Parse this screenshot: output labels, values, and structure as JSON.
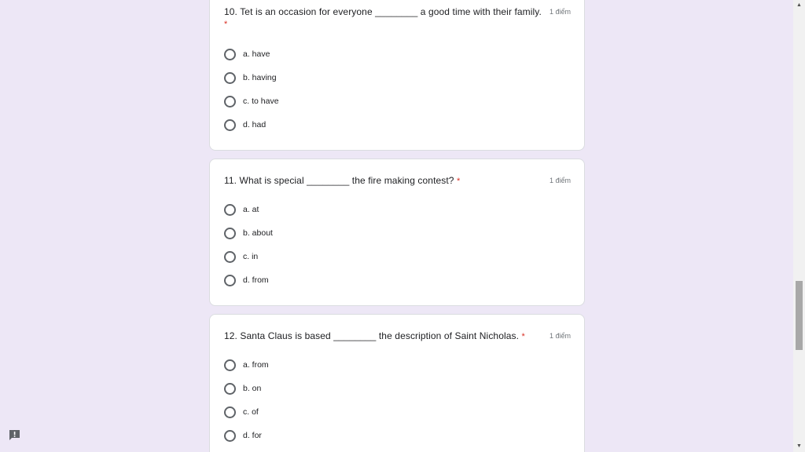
{
  "questions": [
    {
      "title": "10. Tet is an occasion for everyone ________ a good time with their family.",
      "required_mark": "*",
      "points": "1 điểm",
      "options": [
        "a. have",
        "b. having",
        "c. to have",
        "d. had"
      ]
    },
    {
      "title": "11. What is special ________ the fire making contest?",
      "required_mark": "*",
      "points": "1 điểm",
      "options": [
        "a. at",
        "b. about",
        "c. in",
        "d. from"
      ]
    },
    {
      "title": "12. Santa Claus is based ________ the description of Saint Nicholas.",
      "required_mark": "*",
      "points": "1 điểm",
      "options": [
        "a. from",
        "b. on",
        "c. of",
        "d. for"
      ]
    }
  ],
  "icons": {
    "feedback": "report-feedback-icon",
    "scroll_up": "scroll-up-arrow",
    "scroll_down": "scroll-down-arrow"
  },
  "colors": {
    "background": "#ede7f6",
    "required": "#d93025",
    "radio_border": "#5f6368"
  }
}
